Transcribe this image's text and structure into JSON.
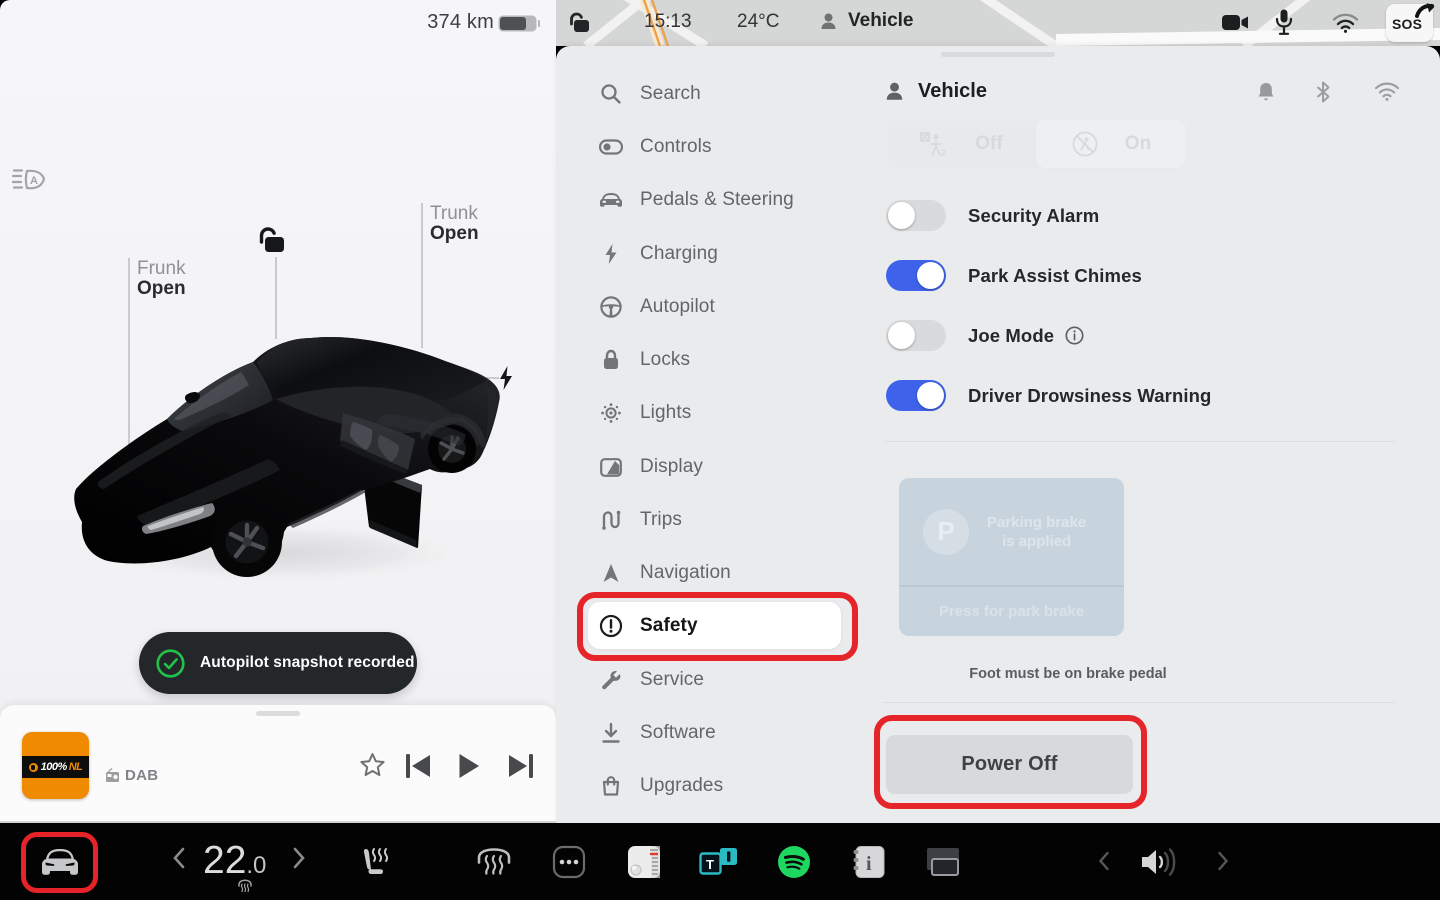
{
  "left_pane": {
    "range": "374 km",
    "battery_icon": "battery-70",
    "headlight_icon": "auto-headlight",
    "lock_icon": "unlocked-padlock",
    "charge_icon": "lightning-bolt",
    "callouts": {
      "frunk": {
        "name": "Frunk",
        "state": "Open"
      },
      "trunk": {
        "name": "Trunk",
        "state": "Open"
      }
    },
    "toast": {
      "icon": "check-circle",
      "message": "Autopilot snapshot recorded",
      "check_color": "#21c24b"
    },
    "media": {
      "station_logo_100": "100%",
      "station_logo_nl": "NL",
      "source_label": "DAB",
      "album_color": "#f08a00",
      "controls": [
        "favorite-star",
        "skip-previous",
        "play",
        "skip-next"
      ]
    }
  },
  "status_bar": {
    "lock_icon": "unlocked-padlock",
    "time": "15:13",
    "outside_temp": "24°C",
    "profile": "Vehicle",
    "icons": [
      "dashcam",
      "microphone",
      "wifi"
    ],
    "sos": "SOS"
  },
  "settings": {
    "menu": [
      {
        "label": "Search",
        "icon": "magnifier"
      },
      {
        "label": "Controls",
        "icon": "toggle"
      },
      {
        "label": "Pedals & Steering",
        "icon": "car-front"
      },
      {
        "label": "Charging",
        "icon": "lightning"
      },
      {
        "label": "Autopilot",
        "icon": "steering-wheel"
      },
      {
        "label": "Locks",
        "icon": "padlock"
      },
      {
        "label": "Lights",
        "icon": "bulb"
      },
      {
        "label": "Display",
        "icon": "brightness"
      },
      {
        "label": "Trips",
        "icon": "route"
      },
      {
        "label": "Navigation",
        "icon": "arrow"
      },
      {
        "label": "Safety",
        "icon": "alert-circle",
        "selected": true
      },
      {
        "label": "Service",
        "icon": "wrench"
      },
      {
        "label": "Software",
        "icon": "download"
      },
      {
        "label": "Upgrades",
        "icon": "shopping-bag"
      }
    ],
    "content": {
      "title": "Vehicle",
      "header_icons": [
        "bell",
        "bluetooth",
        "wifi"
      ],
      "segmented": {
        "off_label": "Off",
        "on_label": "On",
        "selected": "On"
      },
      "toggles": [
        {
          "label": "Security Alarm",
          "state": "off"
        },
        {
          "label": "Park Assist Chimes",
          "state": "on"
        },
        {
          "label": "Joe Mode",
          "state": "off",
          "info": true
        },
        {
          "label": "Driver Drowsiness Warning",
          "state": "on"
        }
      ],
      "park_brake": {
        "p_letter": "P",
        "status_line1": "Parking brake",
        "status_line2": "is applied",
        "action": "Press for park brake"
      },
      "foot_note": "Foot must be on brake pedal",
      "power_button": "Power Off"
    }
  },
  "bottom_bar": {
    "car_icon": "car-front",
    "climate": {
      "temp": "22",
      "temp_decimal": ".0",
      "defrost_mini": "windshield-heat"
    },
    "icons": [
      "seat-heater",
      "front-defrost",
      "more-apps",
      "radio-app",
      "tunein-app",
      "spotify-app",
      "manual-app",
      "theater-app"
    ],
    "volume_icon": "speaker"
  },
  "colors": {
    "accent_blue": "#3e63ea",
    "annotation_red": "#e52529",
    "toast_green": "#21c24b",
    "spotify_green": "#1ed760",
    "album_orange": "#f08a00",
    "tunein_teal": "#2cbac2"
  }
}
